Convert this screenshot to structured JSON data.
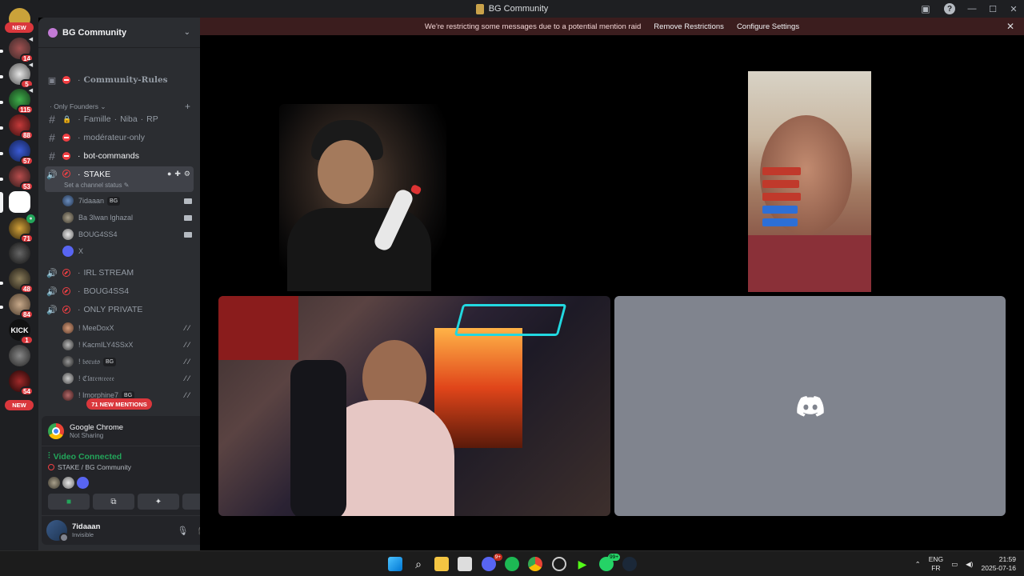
{
  "window": {
    "title": "BG Community"
  },
  "notice": {
    "message": "We're restricting some messages due to a potential mention raid",
    "remove_label": "Remove Restrictions",
    "configure_label": "Configure Settings"
  },
  "rail": {
    "new_top": "NEW",
    "new_bottom": "NEW",
    "badges": [
      "14",
      "5",
      "115",
      "88",
      "57",
      "53",
      "71",
      "48",
      "84",
      "1",
      "54"
    ],
    "kick_label": "KICK"
  },
  "server": {
    "name": "BG Community"
  },
  "channels": {
    "rules": "Community-Rules",
    "category": "Only Founders",
    "c1_parts": [
      "Famille",
      "Niba",
      "RP"
    ],
    "c2": "modérateur-only",
    "c3": "bot-commands",
    "voice_selected": "STAKE",
    "status_placeholder": "Set a channel status",
    "voice_users": [
      {
        "name": "7idaaan",
        "tag": "BG"
      },
      {
        "name": "Ba 3lwan lghazal",
        "tag": ""
      },
      {
        "name": "BOUG4SS4",
        "tag": ""
      },
      {
        "name": "X",
        "tag": ""
      }
    ],
    "v2": "IRL STREAM",
    "v3": "BOUG4SS4",
    "v4": "ONLY PRIVATE",
    "private_users": [
      {
        "name": "! MeeDoxX",
        "tag": ""
      },
      {
        "name": "! KacmILY4SSxX",
        "tag": ""
      },
      {
        "name": "! 𝔟𝔬𝔯𝔲𝔱𝔬",
        "tag": "BG"
      },
      {
        "name": "! ℭ𝔩𝔞𝔯𝔢𝔫𝔠𝔢𝔢𝔢𝔢",
        "tag": ""
      },
      {
        "name": "! Imorphine7",
        "tag": "BG"
      }
    ],
    "mentions_pill": "71 NEW MENTIONS"
  },
  "panel": {
    "share_app": "Google Chrome",
    "share_status": "Not Sharing",
    "video_connected": "Video Connected",
    "location": "STAKE / BG Community",
    "user_name": "7idaaan",
    "user_status": "Invisible"
  },
  "taskbar": {
    "lang_top": "ENG",
    "lang_bottom": "FR",
    "time": "21:59",
    "date": "2025-07-16",
    "discord_badge": "9+",
    "whatsapp_badge": "99+"
  },
  "colors": {
    "accent_red": "#da373c",
    "online_green": "#23a55a",
    "sidebar_bg": "#2b2d31",
    "rail_bg": "#1e1f22",
    "empty_tile": "#80848e"
  }
}
